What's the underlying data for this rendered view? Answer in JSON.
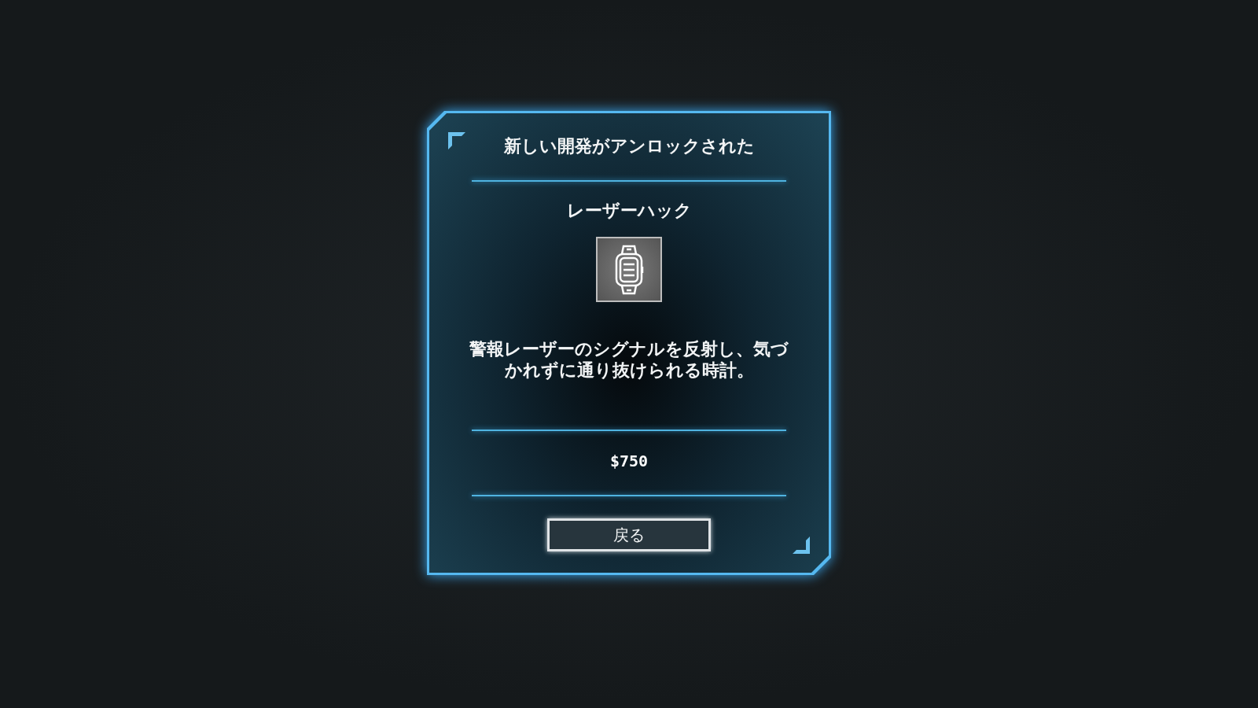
{
  "dialog": {
    "title": "新しい開発がアンロックされた",
    "item": {
      "name": "レーザーハック",
      "description": "警報レーザーのシグナルを反射し、気づかれずに通り抜けられる時計。",
      "price": "$750"
    },
    "buttons": [
      {
        "label": "戻る"
      }
    ]
  }
}
